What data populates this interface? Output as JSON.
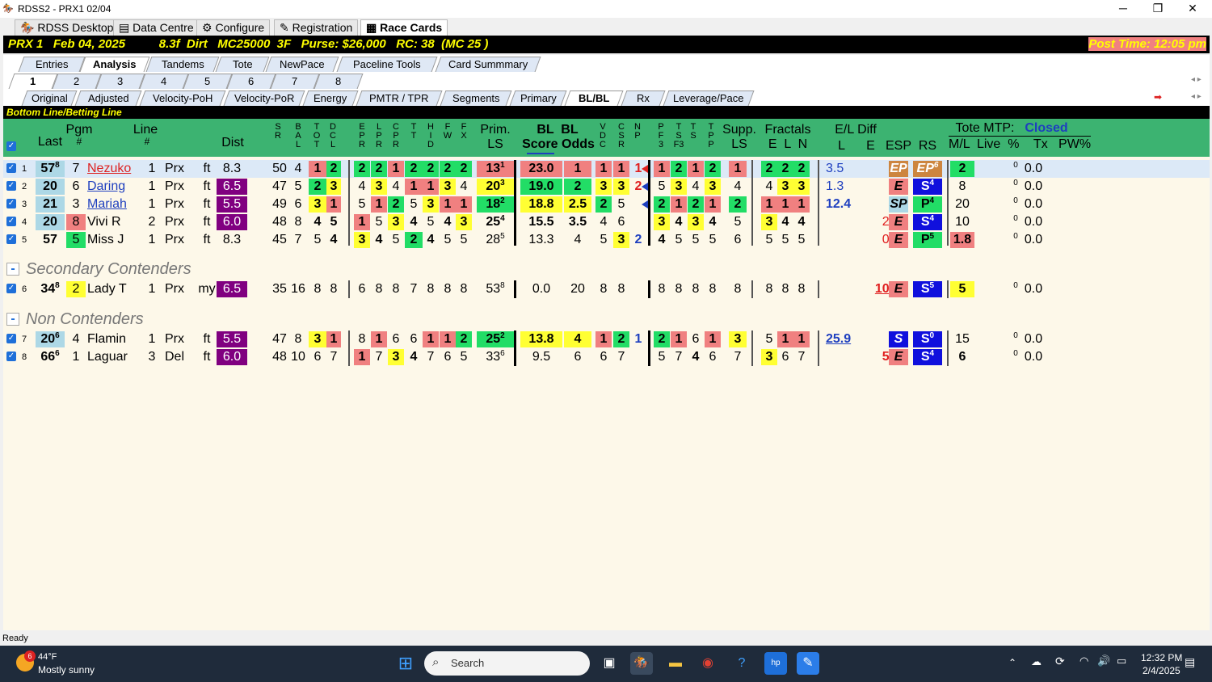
{
  "window": {
    "title": "RDSS2 - PRX1  02/04"
  },
  "toptabs": [
    "RDSS Desktop",
    "Data Centre",
    "Configure",
    "Registration",
    "Race Cards"
  ],
  "race": {
    "info": "PRX 1   Feb 04, 2025          8.3f  Dirt   MC25000  3F   Purse: $26,000   RC: 38  (MC 25 )",
    "post": "Post Time: 12:05 pm"
  },
  "viewtabs": [
    "Entries",
    "Analysis",
    "Tandems",
    "Tote",
    "NewPace",
    "Paceline Tools",
    "Card Summmary"
  ],
  "racetabs": [
    "1",
    "2",
    "3",
    "4",
    "5",
    "6",
    "7",
    "8"
  ],
  "subtabs": [
    "Original",
    "Adjusted",
    "Velocity-PoH",
    "Velocity-PoR",
    "Energy",
    "PMTR / TPR",
    "Segments",
    "Primary",
    "BL/BL",
    "Rx",
    "Leverage/Pace"
  ],
  "section": "Bottom Line/Betting Line",
  "headers": {
    "last": "Last",
    "pgm": "Pgm",
    "pgmn": "#",
    "line": "Line",
    "linen": "#",
    "dist": "Dist",
    "prim": "Prim.",
    "ls": "LS",
    "bl1": "BL  BL",
    "bl2": "Score Odds",
    "supp": "Supp.",
    "suppls": "LS",
    "fractals": "Fractals",
    "eln": "E  L  N",
    "eldiff": "E/L Diff",
    "le": "L      E",
    "esp": "ESP",
    "rs": "RS",
    "tote": "Tote MTP:",
    "closed": "Closed",
    "toteline": "M/L  Live  %    Tx   PW%"
  },
  "groups": {
    "secondary": "Secondary Contenders",
    "non": "Non Contenders"
  },
  "status": "Ready",
  "taskbar": {
    "weather_temp": "44°F",
    "weather_desc": "Mostly sunny",
    "badge": "6",
    "search": "Search",
    "time": "12:32 PM",
    "date": "2/4/2025"
  }
}
